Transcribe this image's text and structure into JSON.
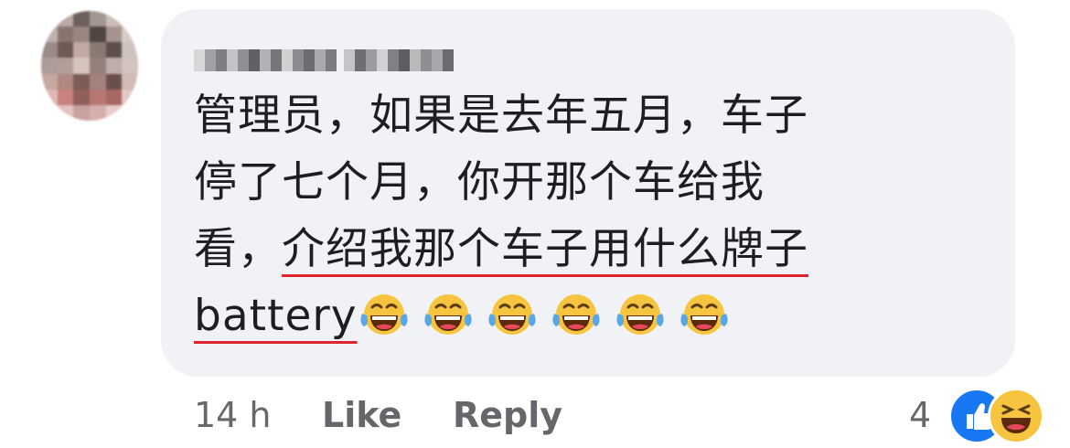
{
  "comment": {
    "lines": [
      "管理员，如果是去年五月，车子",
      "停了七个月，你开那个车给我",
      "看，"
    ],
    "underlined_part": "介绍我那个车子用什么牌子",
    "underlined_word": "battery",
    "emoji_count": 6,
    "emoji_name": "laughing-tears-emoji"
  },
  "footer": {
    "time": "14 h",
    "like_label": "Like",
    "reply_label": "Reply",
    "reaction_count": "4"
  },
  "colors": {
    "bubble": "#f0f2f5",
    "underline": "#e0242e",
    "like_blue": "#1877f2",
    "haha_yellow": "#f7c43f"
  }
}
